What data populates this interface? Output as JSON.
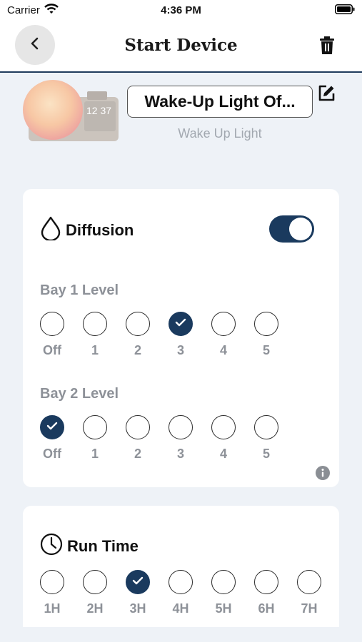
{
  "status_bar": {
    "carrier": "Carrier",
    "time": "4:36 PM"
  },
  "nav": {
    "title": "Start Device"
  },
  "device": {
    "name": "Wake-Up Light Of...",
    "type": "Wake Up Light",
    "clock_display": "12 37"
  },
  "diffusion": {
    "title": "Diffusion",
    "enabled": true,
    "bay1": {
      "label": "Bay 1 Level",
      "options": [
        "Off",
        "1",
        "2",
        "3",
        "4",
        "5"
      ],
      "selected": "3"
    },
    "bay2": {
      "label": "Bay 2 Level",
      "options": [
        "Off",
        "1",
        "2",
        "3",
        "4",
        "5"
      ],
      "selected": "Off"
    }
  },
  "run_time": {
    "title": "Run Time",
    "options": [
      "1H",
      "2H",
      "3H",
      "4H",
      "5H",
      "6H",
      "7H"
    ],
    "selected": "3H"
  },
  "colors": {
    "accent": "#1a3a5e",
    "muted_text": "#8d9198",
    "background": "#eef2f7"
  }
}
